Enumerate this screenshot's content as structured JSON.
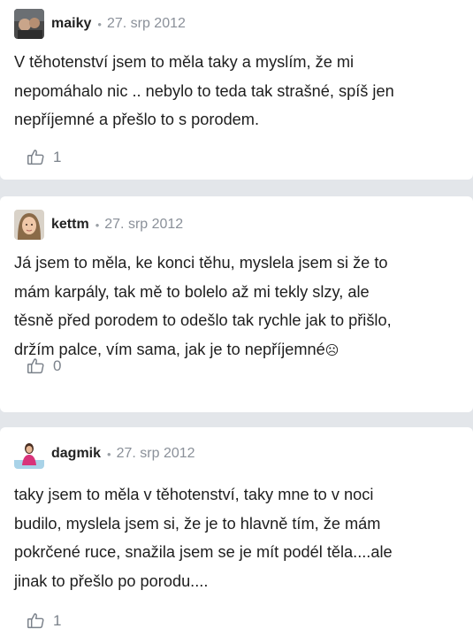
{
  "comments": [
    {
      "author": "maiky",
      "separator": "•",
      "date": "27. srp 2012",
      "text": "V těhotenství jsem to měla taky a myslím, že mi\nnepomáhalo nic .. nebylo to teda tak strašné, spíš jen\nnepříjemné a přešlo to s porodem.",
      "likes": "1"
    },
    {
      "author": "kettm",
      "separator": "•",
      "date": "27. srp 2012",
      "text": "Já jsem to měla, ke konci těhu, myslela jsem si že to\nmám karpály, tak mě to bolelo až mi tekly slzy, ale\ntěsně před porodem to odešlo tak rychle jak to přišlo,\ndržím palce, vím sama, jak je to nepříjemné",
      "emoji": "☹",
      "likes": "0"
    },
    {
      "author": "dagmik",
      "separator": "•",
      "date": "27. srp 2012",
      "text": "taky jsem to měla v těhotenství, taky mne to v noci\nbudilo, myslela jsem si, že je to hlavně tím, že mám\npokrčené ruce, snažila jsem se je mít podél těla....ale\njinak to přešlo po porodu....",
      "likes": "1"
    }
  ],
  "icons": {
    "like": "thumbs-up-outline-icon",
    "avatar_1": "avatar-photo",
    "avatar_2": "avatar-photo",
    "avatar_3": "avatar-photo"
  },
  "colors": {
    "background": "#e3e6ea",
    "card": "#ffffff",
    "meta": "#8a9099"
  }
}
